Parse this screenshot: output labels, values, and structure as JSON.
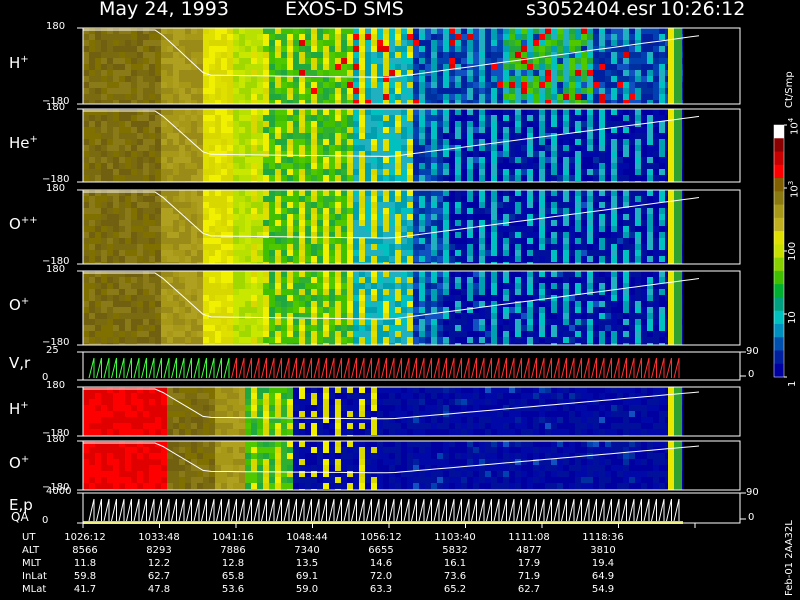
{
  "header": {
    "date": "May 24, 1993",
    "instrument": "EXOS-D SMS",
    "file": "s3052404.esr",
    "time": "10:26:12"
  },
  "chart_data": {
    "type": "heatmap",
    "panels": [
      {
        "id": "h-plus-1",
        "label": "H",
        "sup": "+",
        "ytop": "180",
        "ybot": "−180",
        "ylim": [
          -180,
          180
        ]
      },
      {
        "id": "he-plus",
        "label": "He",
        "sup": "+",
        "ytop": "180",
        "ybot": "−180",
        "ylim": [
          -180,
          180
        ]
      },
      {
        "id": "o-plusplus",
        "label": "O",
        "sup": "++",
        "ytop": "180",
        "ybot": "−180",
        "ylim": [
          -180,
          180
        ]
      },
      {
        "id": "o-plus-1",
        "label": "O",
        "sup": "+",
        "ytop": "180",
        "ybot": "−180",
        "ylim": [
          -180,
          180
        ]
      },
      {
        "id": "vr",
        "label": "V,r",
        "sup": "",
        "ytop": "25",
        "ybot": "0",
        "ylim": [
          0,
          25
        ],
        "right_ticks": [
          "90",
          "0"
        ]
      },
      {
        "id": "h-plus-2",
        "label": "H",
        "sup": "+",
        "ytop": "180",
        "ybot": "−180",
        "ylim": [
          -180,
          180
        ]
      },
      {
        "id": "o-plus-2",
        "label": "O",
        "sup": "+",
        "ytop": "180",
        "ybot": "−180",
        "ylim": [
          -180,
          180
        ]
      },
      {
        "id": "ep",
        "label": "E,p",
        "sup": "",
        "ytop": "4000",
        "ybot": "0",
        "ylim": [
          0,
          4000
        ],
        "right_ticks": [
          "90",
          "0"
        ]
      }
    ],
    "colorbar": {
      "unit": "Ct/Smp",
      "ticks": [
        {
          "base": "10",
          "exp": "4",
          "frac": 0.0
        },
        {
          "base": "10",
          "exp": "3",
          "frac": 0.25
        },
        {
          "base": "100",
          "exp": "",
          "frac": 0.5
        },
        {
          "base": "10",
          "exp": "",
          "frac": 0.75
        },
        {
          "base": "1",
          "exp": "",
          "frac": 1.0
        }
      ],
      "colors": [
        "#ffffff",
        "#8b0000",
        "#c80000",
        "#ff0000",
        "#806000",
        "#8a7a10",
        "#a89818",
        "#c0b020",
        "#e0e000",
        "#c8e000",
        "#88d000",
        "#40c000",
        "#00b030",
        "#00a080",
        "#00c0c0",
        "#0090c0",
        "#0050b0",
        "#0020a0",
        "#0000a0"
      ]
    },
    "qa_label": "QA",
    "ephemeris": {
      "row_labels": [
        "UT",
        "ALT",
        "MLT",
        "InLat",
        "MLat"
      ],
      "columns": [
        [
          "1026:12",
          "8566",
          "11.8",
          "59.8",
          "41.7"
        ],
        [
          "1033:48",
          "8293",
          "12.2",
          "62.7",
          "47.8"
        ],
        [
          "1041:16",
          "7886",
          "12.8",
          "65.8",
          "53.6"
        ],
        [
          "1048:44",
          "7340",
          "13.5",
          "69.1",
          "59.0"
        ],
        [
          "1056:12",
          "6655",
          "14.6",
          "72.0",
          "63.3"
        ],
        [
          "1103:40",
          "5832",
          "16.1",
          "73.6",
          "65.2"
        ],
        [
          "1111:08",
          "4877",
          "17.9",
          "71.9",
          "62.7"
        ],
        [
          "1118:36",
          "3810",
          "19.4",
          "64.9",
          "54.9"
        ]
      ]
    },
    "footer": "Feb-01 2AA32L"
  }
}
